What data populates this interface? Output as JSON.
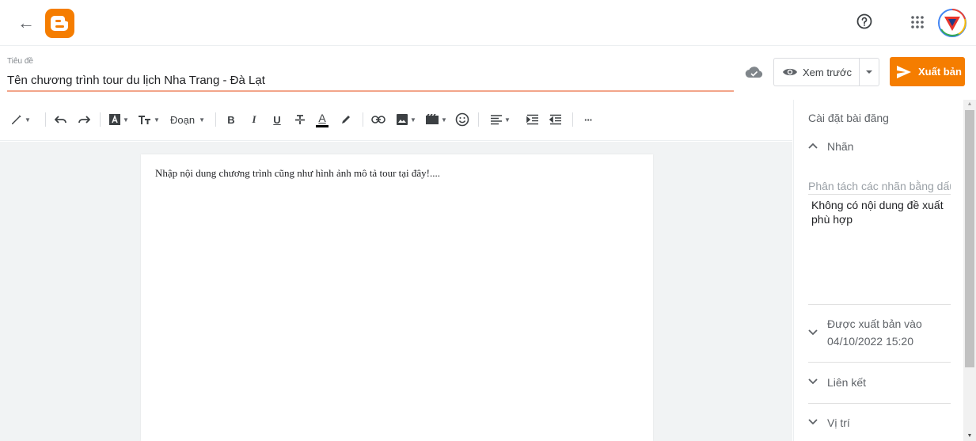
{
  "header": {
    "back_icon": "arrow-left-icon",
    "logo_icon": "blogger-logo-icon",
    "help_icon": "help-circle-icon",
    "apps_icon": "apps-grid-icon",
    "accent": "#f57d00"
  },
  "post": {
    "title_label": "Tiêu đề",
    "title_value": "Tên chương trình tour du lịch Nha Trang - Đà Lạt",
    "body_text": "Nhập nội dung chương trình cũng như hình ảnh mô tả tour tại đây!...."
  },
  "actions": {
    "preview_label": "Xem trước",
    "publish_label": "Xuất bản"
  },
  "toolbar": {
    "paragraph_label": "Đoạn",
    "items": [
      "pencil-icon",
      "undo-icon",
      "redo-icon",
      "font-icon",
      "font-size-icon",
      "bold-icon",
      "italic-icon",
      "underline-icon",
      "strikethrough-icon",
      "text-color-icon",
      "highlight-icon",
      "link-icon",
      "image-icon",
      "video-icon",
      "emoji-icon",
      "align-icon",
      "indent-icon",
      "outdent-icon",
      "more-icon"
    ],
    "bold": "B",
    "italic": "I",
    "underline": "U",
    "text_color": "A",
    "more": "···"
  },
  "settings": {
    "title": "Cài đặt bài đăng",
    "labels": {
      "heading": "Nhãn",
      "placeholder": "Phân tách các nhãn bằng dấu phẩy",
      "suggestion": "Không có nội dung đề xuất phù hợp"
    },
    "published": {
      "heading": "Được xuất bản vào",
      "datetime": "04/10/2022 15:20"
    },
    "links": {
      "heading": "Liên kết"
    },
    "location": {
      "heading": "Vị trí"
    }
  }
}
